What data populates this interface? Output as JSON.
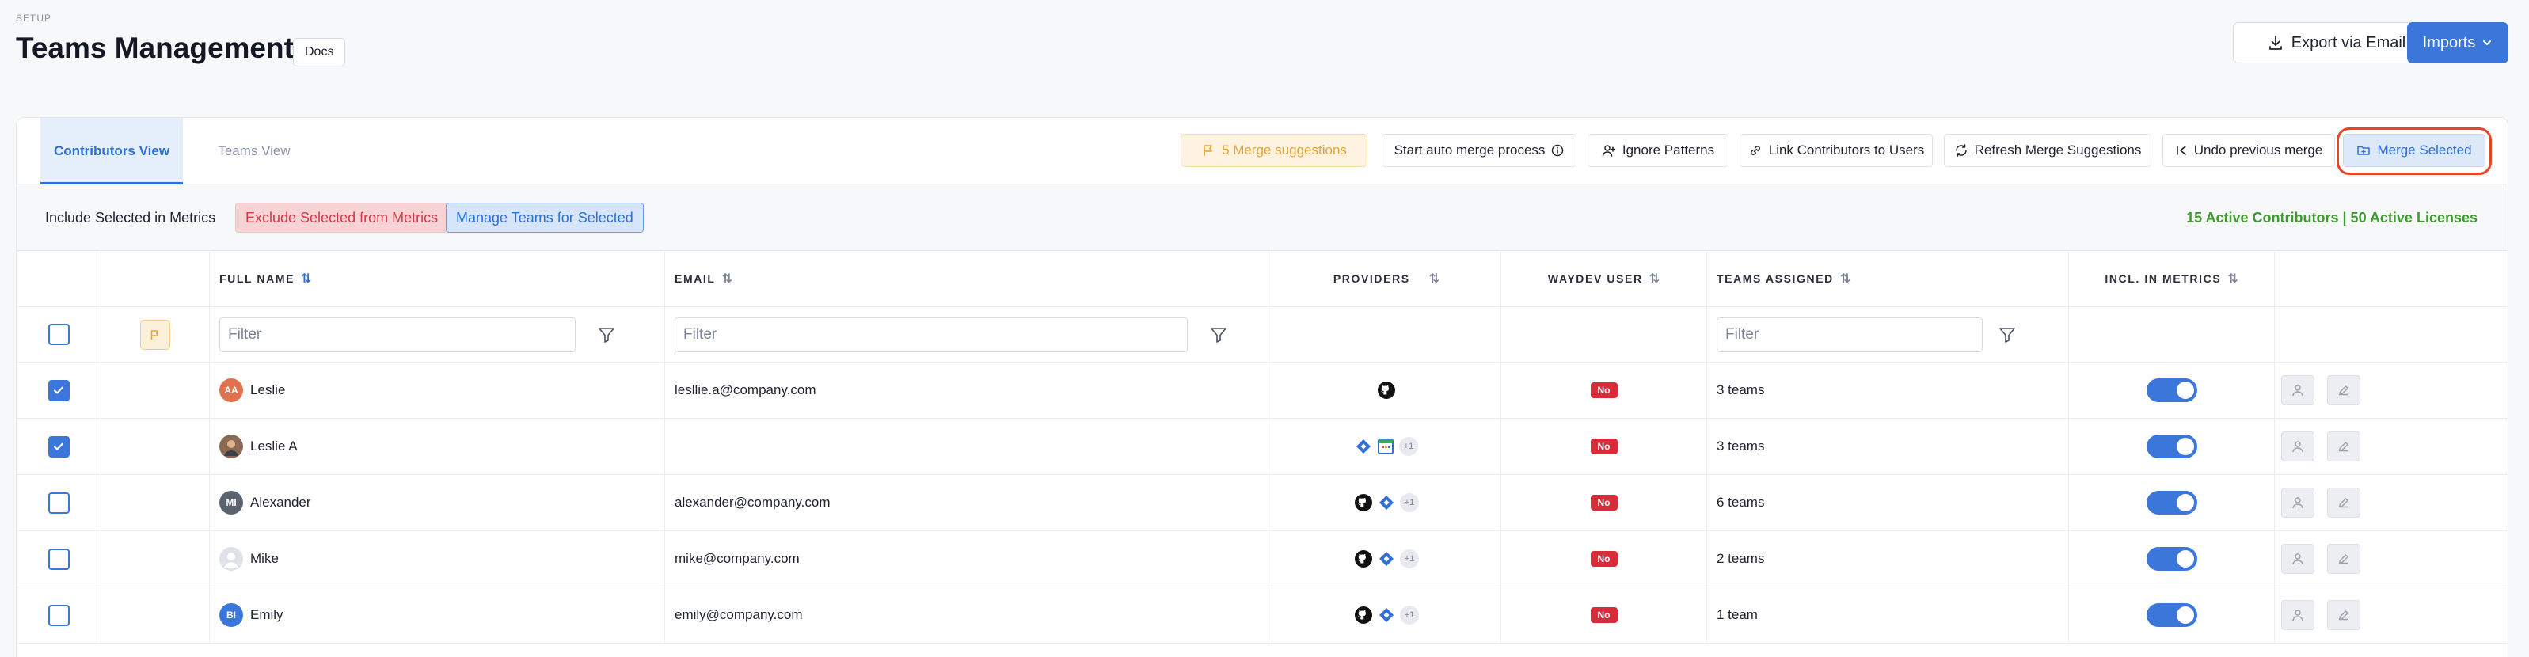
{
  "header": {
    "section": "SETUP",
    "title": "Teams Management",
    "docs_label": "Docs",
    "export_label": "Export via Email",
    "imports_label": "Imports"
  },
  "tabs": {
    "contributors": "Contributors View",
    "teams": "Teams View"
  },
  "toolbar": {
    "merge_suggestions": "5 Merge suggestions",
    "auto_merge": "Start auto merge process",
    "ignore_patterns": "Ignore Patterns",
    "link_contributors": "Link Contributors to Users",
    "refresh_merge": "Refresh Merge Suggestions",
    "undo_merge": "Undo previous merge",
    "merge_selected": "Merge Selected"
  },
  "actions": {
    "include": "Include Selected in Metrics",
    "exclude": "Exclude Selected from Metrics",
    "manage_teams": "Manage Teams for Selected",
    "summary": "15 Active Contributors | 50 Active Licenses"
  },
  "columns": {
    "full_name": "FULL NAME",
    "email": "EMAIL",
    "providers": "PROVIDERS",
    "waydev_user": "WAYDEV USER",
    "teams_assigned": "TEAMS ASSIGNED",
    "incl_metrics": "INCL. IN METRICS"
  },
  "filters": {
    "name_placeholder": "Filter",
    "email_placeholder": "Filter",
    "teams_placeholder": "Filter"
  },
  "rows": [
    {
      "checked": true,
      "initials": "AA",
      "avatar_color": "#e0724f",
      "name": "Leslie",
      "email": "lesllie.a@company.com",
      "providers": [
        "github"
      ],
      "more": "",
      "waydev": "No",
      "teams": "3 teams"
    },
    {
      "checked": true,
      "initials": "",
      "avatar_color": "#6b4a3a",
      "name": "Leslie A",
      "email": "",
      "providers": [
        "jira",
        "calendar"
      ],
      "more": "+1",
      "waydev": "No",
      "teams": "3 teams"
    },
    {
      "checked": false,
      "initials": "MI",
      "avatar_color": "#5c6370",
      "name": "Alexander",
      "email": "alexander@company.com",
      "providers": [
        "github",
        "jira"
      ],
      "more": "+1",
      "waydev": "No",
      "teams": "6 teams"
    },
    {
      "checked": false,
      "initials": "",
      "avatar_color": "#cfd3da",
      "name": "Mike",
      "email": "mike@company.com",
      "providers": [
        "github",
        "jira"
      ],
      "more": "+1",
      "waydev": "No",
      "teams": "2 teams"
    },
    {
      "checked": false,
      "initials": "BI",
      "avatar_color": "#3b77db",
      "name": "Emily",
      "email": "emily@company.com",
      "providers": [
        "github",
        "jira"
      ],
      "more": "+1",
      "waydev": "No",
      "teams": "1 team"
    }
  ],
  "colors": {
    "primary": "#3b77db",
    "danger": "#d92c3a",
    "success": "#3f9b2e",
    "warning": "#e6a33a"
  }
}
